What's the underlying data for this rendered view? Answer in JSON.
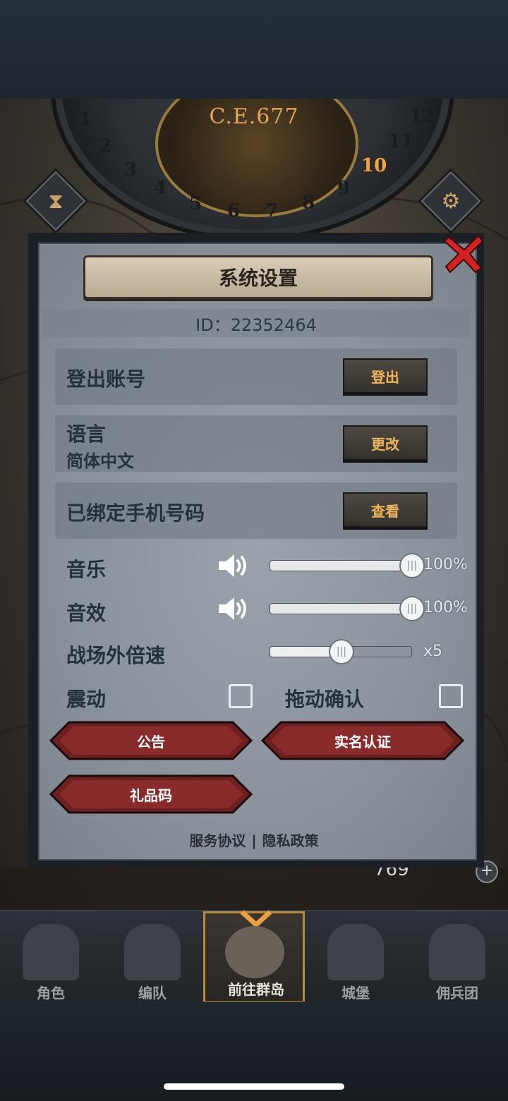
{
  "game": {
    "era": "C.E.677",
    "dial_numbers": [
      "1",
      "2",
      "3",
      "4",
      "5",
      "6",
      "7",
      "8",
      "9",
      "10",
      "11",
      "12"
    ],
    "highlighted_number": "10",
    "resource_value": "769"
  },
  "dialog": {
    "title": "系统设置",
    "id_text": "ID：22352464",
    "logout": {
      "label": "登出账号",
      "button": "登出"
    },
    "language": {
      "label": "语言",
      "value": "简体中文",
      "button": "更改"
    },
    "phone": {
      "label": "已绑定手机号码",
      "button": "查看"
    },
    "music": {
      "label": "音乐",
      "value": "100%",
      "level": 1.0
    },
    "sfx": {
      "label": "音效",
      "value": "100%",
      "level": 1.0
    },
    "speed": {
      "label": "战场外倍速",
      "value": "x5",
      "level": 0.5
    },
    "vibration": {
      "label": "震动",
      "checked": false
    },
    "drag_confirm": {
      "label": "拖动确认",
      "checked": false
    },
    "buttons": {
      "notice": "公告",
      "real_name": "实名认证",
      "gift_code": "礼品码"
    },
    "links": {
      "service": "服务协议",
      "separator": "|",
      "privacy": "隐私政策"
    }
  },
  "nav": {
    "items": [
      {
        "label": "角色"
      },
      {
        "label": "编队"
      },
      {
        "label": "前往群岛",
        "active": true
      },
      {
        "label": "城堡"
      },
      {
        "label": "佣兵团"
      }
    ]
  },
  "colors": {
    "accent_gold": "#f0b55a",
    "button_red": "#7a2424",
    "panel_gray": "#8a929b",
    "close_red": "#d42222"
  }
}
